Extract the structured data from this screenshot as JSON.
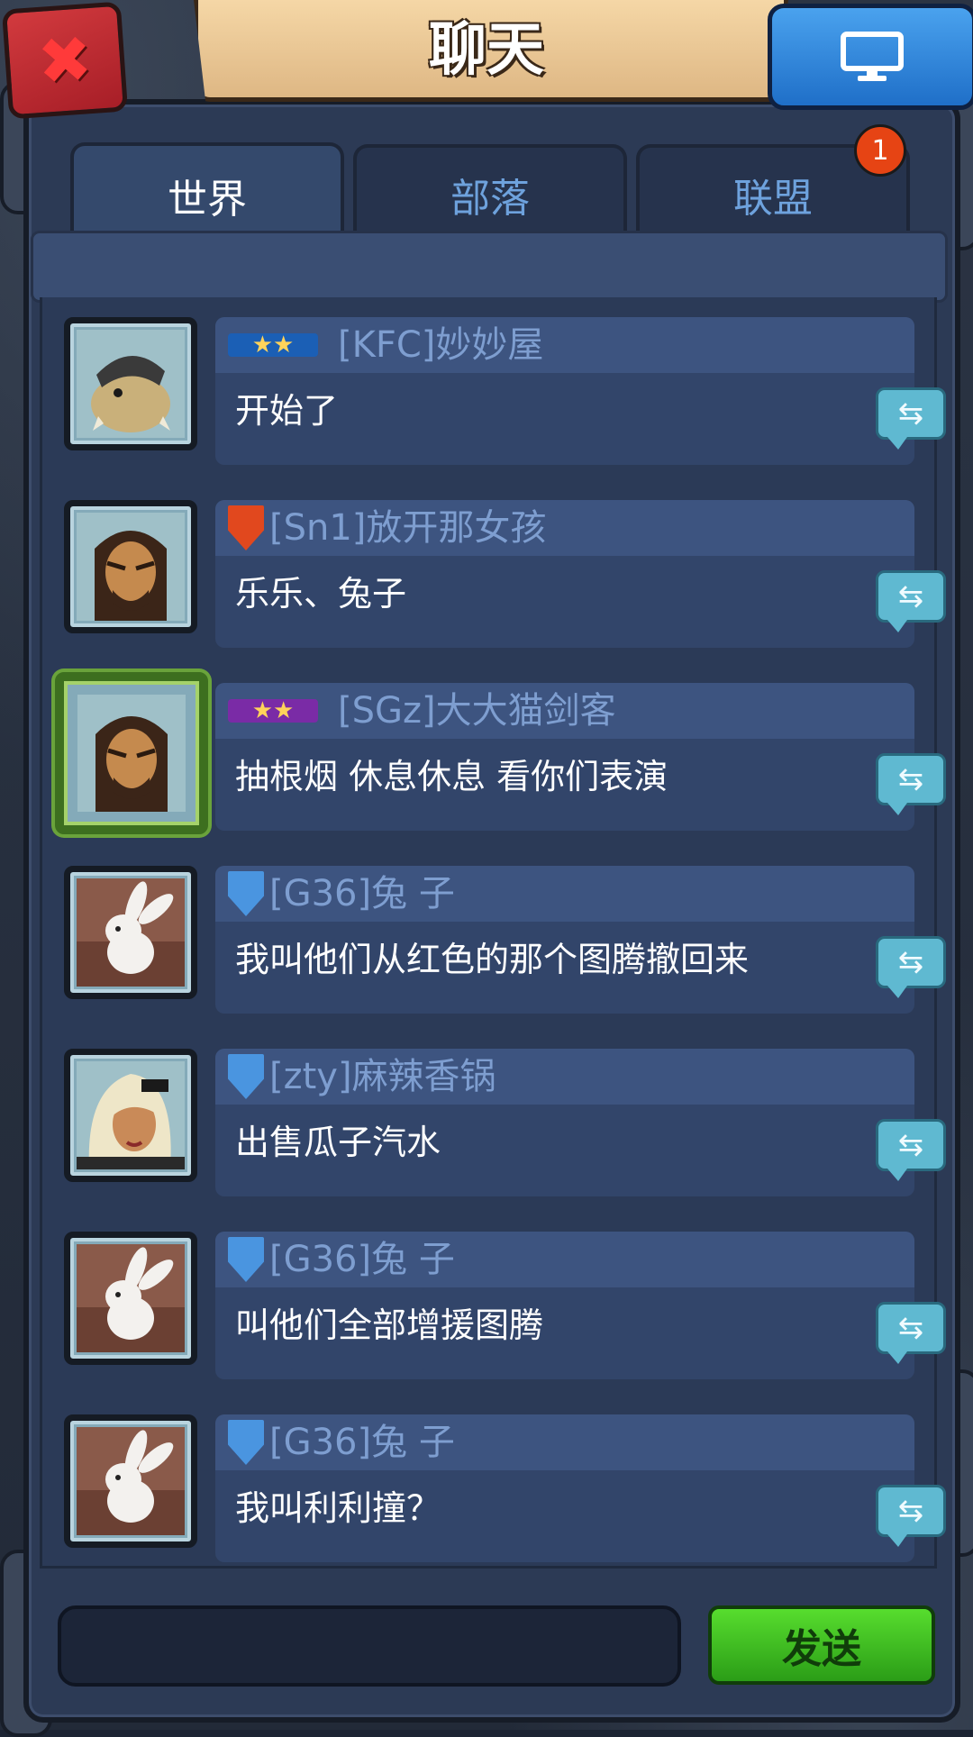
{
  "header": {
    "title": "聊天"
  },
  "tabs": [
    {
      "label": "世界",
      "active": true
    },
    {
      "label": "部落",
      "active": false
    },
    {
      "label": "联盟",
      "active": false
    }
  ],
  "badge": {
    "count": "1"
  },
  "messages": [
    {
      "rank": "star-ribbon-blue",
      "sender": "[KFC]妙妙屋",
      "text": "开始了",
      "avatar": "creature"
    },
    {
      "rank": "shield-red",
      "sender": "[Sn1]放开那女孩",
      "text": "乐乐、兔子",
      "avatar": "barbarian"
    },
    {
      "rank": "star-ribbon-purple",
      "sender": "[SGz]大大猫剑客",
      "text": "抽根烟 休息休息 看你们表演",
      "avatar": "barbarian-vip"
    },
    {
      "rank": "shield-blue",
      "sender": "[G36]兔 子",
      "text": "我叫他们从红色的那个图腾撤回来",
      "avatar": "rabbit"
    },
    {
      "rank": "shield-blue",
      "sender": "[zty]麻辣香锅",
      "text": "出售瓜子汽水",
      "avatar": "woman"
    },
    {
      "rank": "shield-blue",
      "sender": "[G36]兔 子",
      "text": "叫他们全部增援图腾",
      "avatar": "rabbit"
    },
    {
      "rank": "shield-blue",
      "sender": "[G36]兔 子",
      "text": "我叫利利撞？",
      "avatar": "rabbit"
    }
  ],
  "footer": {
    "send_label": "发送",
    "input_value": ""
  },
  "colors": {
    "panel": "#2c3a55",
    "bubble": "#32456a",
    "sender_text": "#7e9ed0",
    "send_green": "#3bbf22",
    "badge_red": "#e64414"
  }
}
